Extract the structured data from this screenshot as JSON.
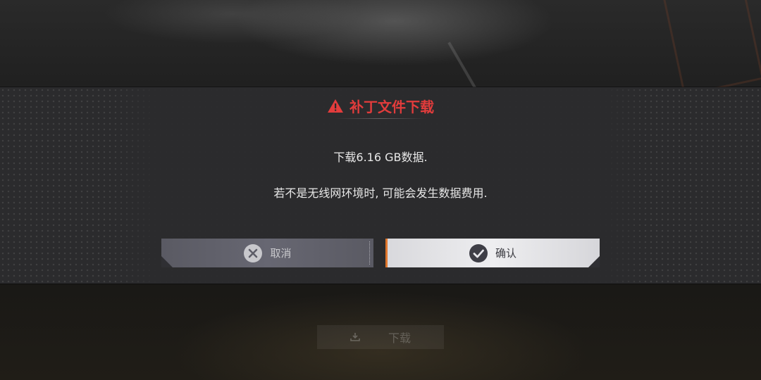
{
  "dialog": {
    "title": "补丁文件下载",
    "message_line1": "下载6.16 GB数据.",
    "message_line2": "若不是无线网环境时, 可能会发生数据费用.",
    "cancel_label": "取消",
    "confirm_label": "确认",
    "icons": {
      "title": "warning-triangle-icon",
      "cancel": "close-circle-icon",
      "confirm": "check-circle-icon"
    }
  },
  "background": {
    "download_label": "下载",
    "download_icon": "download-icon"
  },
  "colors": {
    "title_red": "#e23c3c",
    "confirm_accent": "#e0762c",
    "cancel_bg": "#62626c",
    "confirm_bg": "#e6e6ea"
  }
}
